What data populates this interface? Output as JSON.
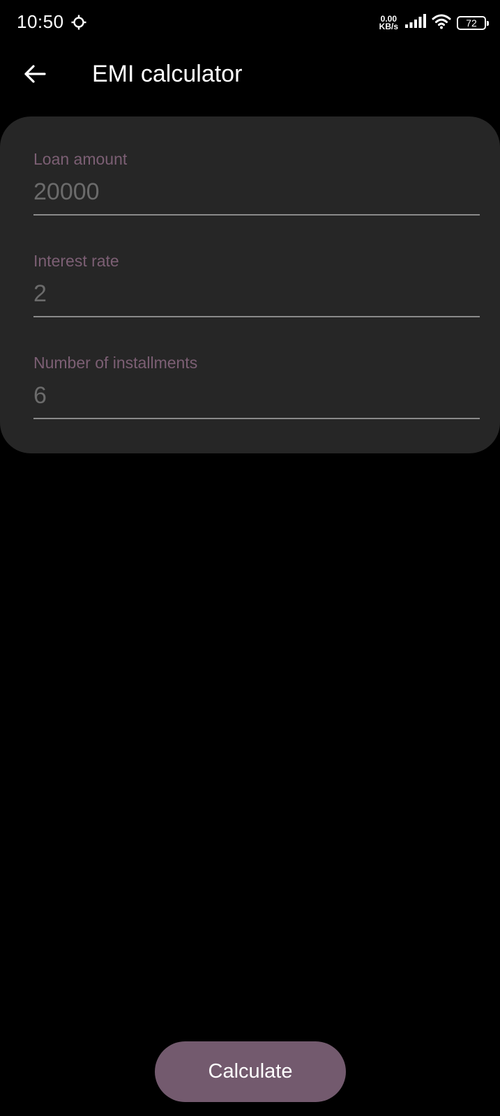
{
  "status_bar": {
    "time": "10:50",
    "net_speed_value": "0.00",
    "net_speed_unit": "KB/s",
    "battery_level": "72",
    "icons": [
      "sync-icon",
      "signal-icon",
      "wifi-icon",
      "battery-icon"
    ]
  },
  "app_bar": {
    "title": "EMI calculator",
    "back_icon": "arrow-back-icon"
  },
  "form": {
    "loan_amount": {
      "label": "Loan amount",
      "placeholder": "20000",
      "value": ""
    },
    "interest_rate": {
      "label": "Interest rate",
      "placeholder": "2",
      "value": ""
    },
    "installments": {
      "label": "Number of installments",
      "placeholder": "6",
      "value": ""
    }
  },
  "actions": {
    "calculate_label": "Calculate"
  },
  "colors": {
    "background": "#000000",
    "card": "#262626",
    "label": "#7c5f74",
    "placeholder": "#6b6b6b",
    "button": "#735a6e",
    "text": "#ffffff"
  }
}
